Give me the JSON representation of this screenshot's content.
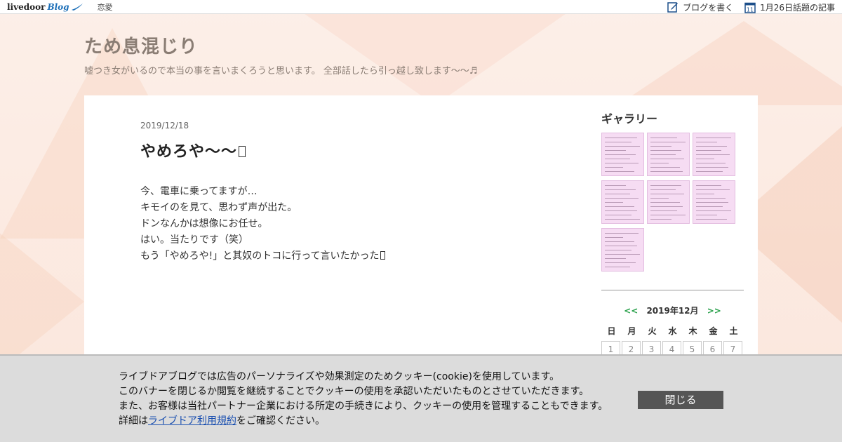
{
  "topbar": {
    "logo_text": "livedoor",
    "logo_blog": "Blog",
    "category": "恋愛",
    "write_blog": "ブログを書く",
    "calendar_day": "11",
    "topic": "1月26日話題の記事"
  },
  "header": {
    "title": "ため息混じり",
    "description": "嘘つき女がいるので本当の事を言いまくろうと思います。 全部話したら引っ越し致します〜〜♬"
  },
  "article": {
    "date": "2019/12/18",
    "title": "やめろや〜〜",
    "lines": [
      "今、電車に乗ってますが…",
      "キモイのを見て、思わず声が出た。",
      "",
      "ドンなんかは想像にお任せ。",
      "",
      "はい。当たりです（笑）",
      "",
      "もう「やめろや!」と其奴のトコに行って言いたかった"
    ]
  },
  "sidebar": {
    "gallery_title": "ギャラリー",
    "thumb_count": 7,
    "calendar": {
      "prev": "<<",
      "month": "2019年12月",
      "next": ">>",
      "weekdays": [
        "日",
        "月",
        "火",
        "水",
        "木",
        "金",
        "土"
      ],
      "first_row": [
        "1",
        "2",
        "3",
        "4",
        "5",
        "6",
        "7"
      ]
    }
  },
  "cookie": {
    "line1": "ライブドアブログでは広告のパーソナライズや効果測定のためクッキー(cookie)を使用しています。",
    "line2": "このバナーを閉じるか閲覧を継続することでクッキーの使用を承認いただいたものとさせていただきます。",
    "line3": "また、お客様は当社パートナー企業における所定の手続きにより、クッキーの使用を管理することもできます。",
    "line4_prefix": "詳細は",
    "line4_link": "ライブドア利用規約",
    "line4_suffix": "をご確認ください。",
    "close_label": "閉じる"
  },
  "colors": {
    "accent_green": "#2aa14c",
    "blog_blue": "#1c6fb8",
    "title_color": "#8a7d74",
    "thumb_pink": "#f6dcf3"
  }
}
